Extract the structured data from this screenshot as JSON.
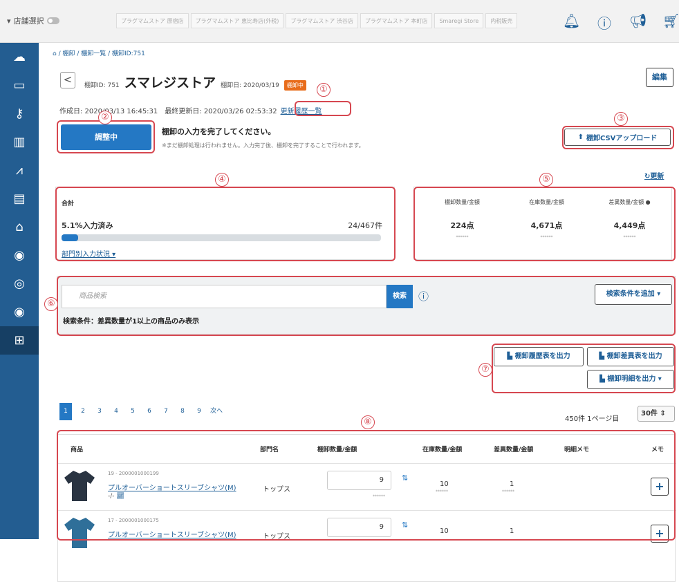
{
  "topbar": {
    "store_select": "店舗選択",
    "stores": [
      "プラグマムストア 原宿店",
      "プラグマムストア 恵比寿店(外税)",
      "プラグマムストア 渋谷店",
      "プラグマムストア 本町店",
      "Smaregi Store",
      "内税販売"
    ]
  },
  "breadcrumb": "/ 棚卸 / 棚卸一覧 / 棚卸ID:751",
  "header": {
    "id_label": "棚卸ID: 751",
    "title": "スマレジストア",
    "date_label": "棚卸日: 2020/03/19",
    "status": "棚卸中",
    "edit": "編集",
    "back": "<"
  },
  "dates": {
    "text": "作成日: 2020/03/13 16:45:31　最終更新日: 2020/03/26 02:53:32",
    "history_link": "更新履歴一覧"
  },
  "actions": {
    "adjust": "調整中",
    "message": "棚卸の入力を完了してください。",
    "note": "※まだ棚卸処理は行われません。入力完了後、棚卸を完了することで行われます。",
    "csv_upload": "棚卸CSVアップロード",
    "refresh": "更新"
  },
  "summary": {
    "title": "合計",
    "progress_label": "5.1%入力済み",
    "progress_count": "24/467件",
    "progress_fraction": 0.051,
    "dept_link": "部門別入力状況"
  },
  "stats": [
    {
      "label": "棚卸数量/金額",
      "value": "224点",
      "amount": "******"
    },
    {
      "label": "在庫数量/金額",
      "value": "4,671点",
      "amount": "******"
    },
    {
      "label": "差異数量/金額",
      "value": "4,449点",
      "amount": "******"
    }
  ],
  "search": {
    "placeholder": "商品検索",
    "button": "検索",
    "add_condition": "検索条件を追加",
    "condition": "検索条件：差異数量が1以上の商品のみ表示"
  },
  "outputs": {
    "history": "棚卸履歴表を出力",
    "diff": "棚卸差異表を出力",
    "detail": "棚卸明細を出力"
  },
  "pagination": {
    "pages": [
      "1",
      "2",
      "3",
      "4",
      "5",
      "6",
      "7",
      "8",
      "9"
    ],
    "next": "次へ",
    "info": "450件 1ページ目",
    "per_page": "30件"
  },
  "table": {
    "headers": [
      "商品",
      "部門名",
      "棚卸数量/金額",
      "在庫数量/金額",
      "差異数量/金額",
      "明細メモ",
      "メモ"
    ],
    "rows": [
      {
        "code": "19 - 2000001000199",
        "name": "プルオーバーショートスリーブシャツ(M)",
        "sub": "-/-",
        "dept": "トップス",
        "qty": "9",
        "stock": "10",
        "diff": "1",
        "mask": "******",
        "color": "#2a3442"
      },
      {
        "code": "17 - 2000001000175",
        "name": "プルオーバーショートスリーブシャツ(M)",
        "sub": "-/-",
        "dept": "トップス",
        "qty": "9",
        "stock": "10",
        "diff": "1",
        "mask": "******",
        "color": "#2f6f99"
      }
    ]
  },
  "annotations": [
    "①",
    "②",
    "③",
    "④",
    "⑤",
    "⑥",
    "⑦",
    "⑧"
  ],
  "colors": {
    "primary": "#2478c4",
    "sidebar": "#235d91",
    "annotation": "#d64750",
    "status": "#e86c1b"
  }
}
